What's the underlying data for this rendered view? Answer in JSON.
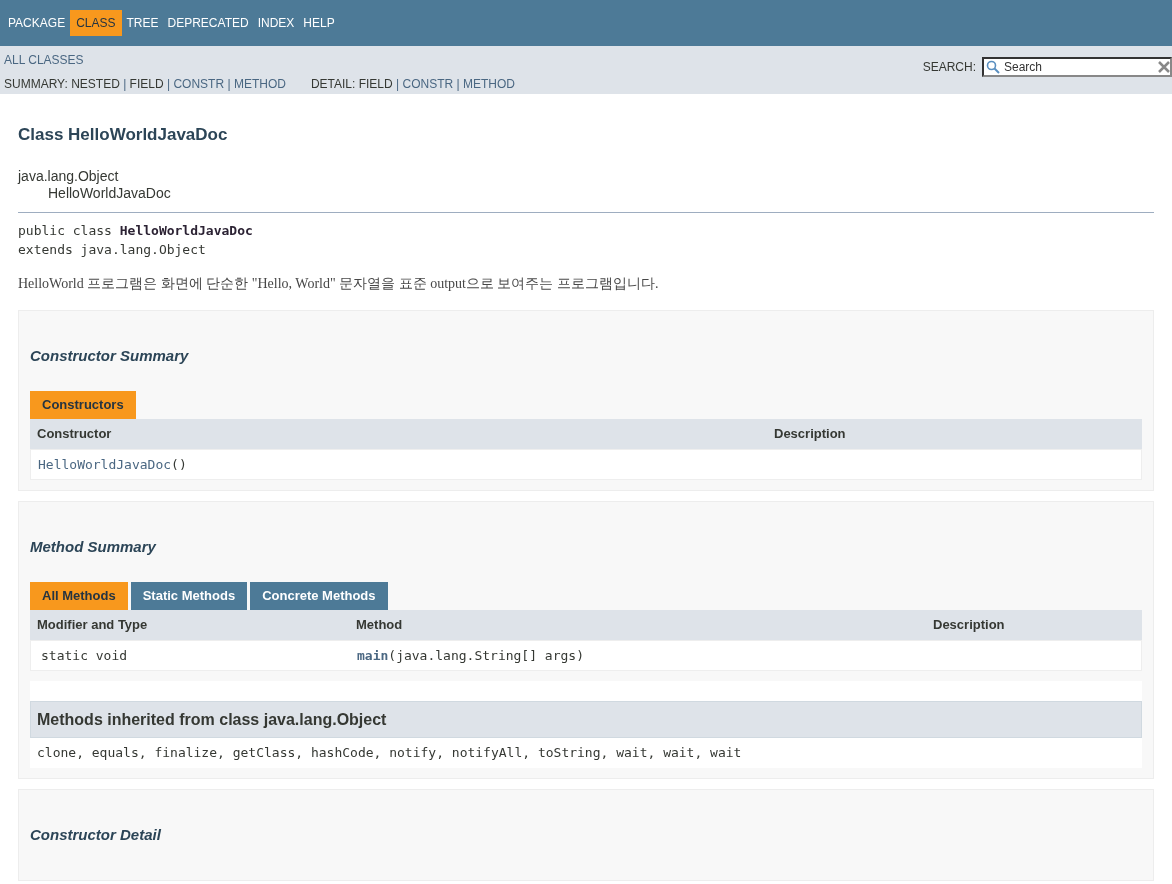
{
  "nav": [
    {
      "label": "PACKAGE",
      "selected": false
    },
    {
      "label": "CLASS",
      "selected": true
    },
    {
      "label": "TREE",
      "selected": false
    },
    {
      "label": "DEPRECATED",
      "selected": false
    },
    {
      "label": "INDEX",
      "selected": false
    },
    {
      "label": "HELP",
      "selected": false
    }
  ],
  "subnav": {
    "all_classes": "ALL CLASSES",
    "summary": {
      "label": "SUMMARY:",
      "separator": "|",
      "items": [
        {
          "label": "NESTED",
          "link": false
        },
        {
          "label": "FIELD",
          "link": false
        },
        {
          "label": "CONSTR",
          "link": true
        },
        {
          "label": "METHOD",
          "link": true
        }
      ]
    },
    "detail": {
      "label": "DETAIL:",
      "separator": "|",
      "items": [
        {
          "label": "FIELD",
          "link": false
        },
        {
          "label": "CONSTR",
          "link": true
        },
        {
          "label": "METHOD",
          "link": true
        }
      ]
    },
    "search": {
      "label": "SEARCH:",
      "placeholder": "Search"
    }
  },
  "class_title": "Class HelloWorldJavaDoc",
  "inheritance": [
    "java.lang.Object",
    "HelloWorldJavaDoc"
  ],
  "signature": {
    "prefix": "public class",
    "name": "HelloWorldJavaDoc",
    "extends": "extends java.lang.Object"
  },
  "description": "HelloWorld 프로그램은 화면에 단순한 \"Hello, World\" 문자열을 표준 output으로 보여주는 프로그램입니다.",
  "constructor_summary": {
    "heading": "Constructor Summary",
    "tabs": [
      {
        "label": "Constructors",
        "selected": true
      }
    ],
    "columns": [
      "Constructor",
      "Description"
    ],
    "rows": [
      {
        "name": "HelloWorldJavaDoc",
        "rest": "()"
      }
    ]
  },
  "method_summary": {
    "heading": "Method Summary",
    "tabs": [
      {
        "label": "All Methods",
        "selected": true
      },
      {
        "label": "Static Methods",
        "selected": false
      },
      {
        "label": "Concrete Methods",
        "selected": false
      }
    ],
    "columns": [
      "Modifier and Type",
      "Method",
      "Description"
    ],
    "rows": [
      {
        "modifier": "static void",
        "name": "main",
        "rest": "(java.lang.String[] args)"
      }
    ],
    "inherited": {
      "heading": "Methods inherited from class java.lang.Object",
      "text": "clone, equals, finalize, getClass, hashCode, notify, notifyAll, toString, wait, wait, wait"
    }
  },
  "constructor_detail": {
    "heading": "Constructor Detail"
  }
}
